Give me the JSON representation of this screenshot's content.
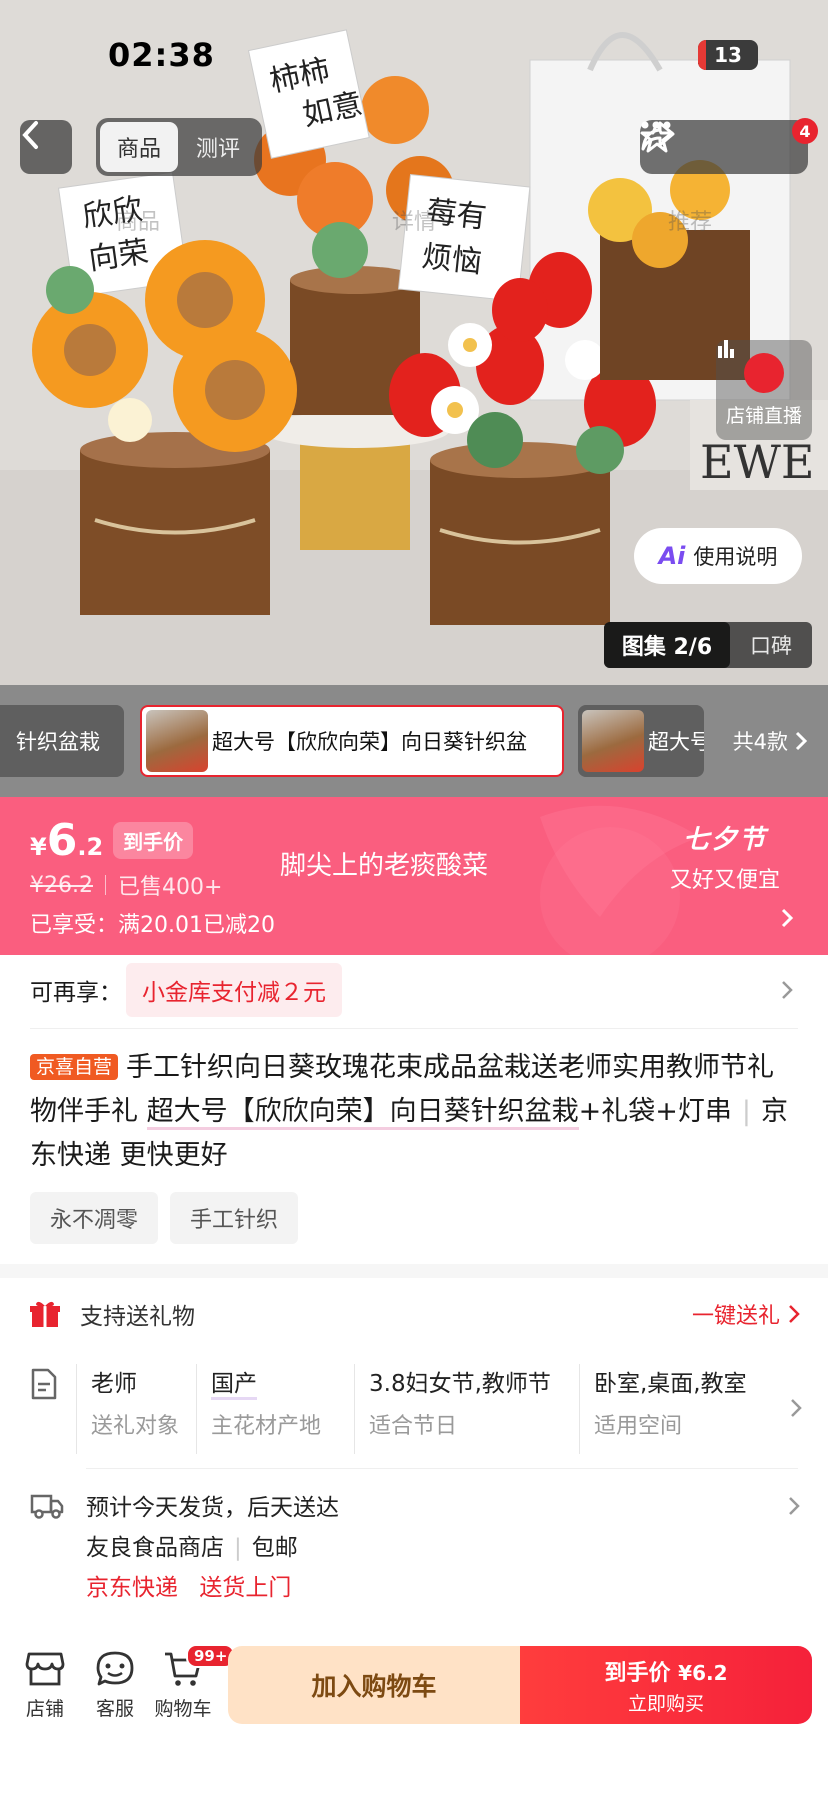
{
  "status_bar": {
    "time": "02:38",
    "battery": "13"
  },
  "nav": {
    "segments": [
      "商品",
      "测评"
    ],
    "badge_count": "4",
    "ghost_tabs": [
      "商品",
      "详情",
      "推荐"
    ]
  },
  "hero": {
    "card_texts": [
      "欣欣向荣",
      "柿柿如意",
      "莓有烦恼"
    ],
    "live_label": "店铺直播",
    "guide_label": "使用说明",
    "gallery_active": "图集 2/6",
    "gallery_other": "口碑"
  },
  "variants": {
    "items": [
      {
        "label": "针织盆栽"
      },
      {
        "label": "超大号【欣欣向荣】向日葵针织盆"
      },
      {
        "label": "超大号"
      }
    ],
    "count_label": "共4款"
  },
  "price": {
    "currency": "¥",
    "integer": "6",
    "decimal": ".2",
    "tag": "到手价",
    "original": "¥26.2",
    "sold": "已售400+",
    "enjoyed": "已享受：满20.01已减20",
    "shop_phrase": "脚尖上的老痰酸菜",
    "festival_title": "七夕节",
    "festival_sub": "又好又便宜"
  },
  "promo": {
    "label": "可再享：",
    "chip": "小金库支付减２元"
  },
  "product": {
    "badge": "京喜自营",
    "title_part1": "手工针织向日葵玫瑰花束成品盆栽送老师实用教师节礼物伴手礼 ",
    "title_highlight": "超大号【欣欣向荣】向日葵针织盆栽",
    "title_part2": "+礼袋+灯串",
    "title_part3": "京东快递 更快更好",
    "tags": [
      "永不凋零",
      "手工针织"
    ]
  },
  "gift": {
    "label": "支持送礼物",
    "action": "一键送礼"
  },
  "attributes": [
    {
      "value": "老师",
      "key": "送礼对象"
    },
    {
      "value": "国产",
      "key": "主花材产地"
    },
    {
      "value": "3.8妇女节,教师节",
      "key": "适合节日"
    },
    {
      "value": "卧室,桌面,教室",
      "key": "适用空间"
    }
  ],
  "shipping": {
    "line1": "预计今天发货，后天送达",
    "shop": "友良食品商店",
    "free": "包邮",
    "carrier": "京东快递",
    "door": "送货上门"
  },
  "bottom": {
    "store": "店铺",
    "service": "客服",
    "cart": "购物车",
    "cart_badge": "99+",
    "add_cart": "加入购物车",
    "buy_top": "到手价",
    "buy_price": "¥6.2",
    "buy_bottom": "立即购买"
  },
  "colors": {
    "accent": "#e8242f",
    "banner": "#fa5e7f",
    "self_badge": "#f05a22"
  }
}
